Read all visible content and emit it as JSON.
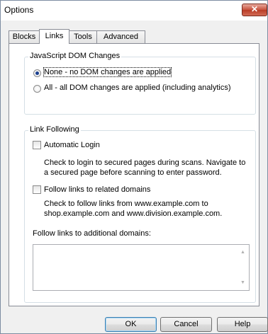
{
  "window": {
    "title": "Options",
    "close_glyph": "✕"
  },
  "tabs": [
    {
      "label": "Blocks",
      "active": false
    },
    {
      "label": "Links",
      "active": true
    },
    {
      "label": "Tools",
      "active": false
    },
    {
      "label": "Advanced",
      "active": false
    }
  ],
  "js_dom": {
    "group_label": "JavaScript DOM Changes",
    "option_none_label": "None - no DOM changes are applied",
    "option_all_label": "All - all DOM changes are applied (including analytics)",
    "selected": "none"
  },
  "link_following": {
    "group_label": "Link Following",
    "auto_login_label": "Automatic Login",
    "auto_login_checked": false,
    "auto_login_desc_1": "Check to login to secured pages during scans. Navigate to",
    "auto_login_desc_2": "a secured page before scanning to enter password.",
    "related_label": "Follow links to related domains",
    "related_checked": false,
    "related_desc_1": "Check to follow links from www.example.com to",
    "related_desc_2": "shop.example.com and www.division.example.com.",
    "additional_label": "Follow links to additional domains:",
    "additional_value": ""
  },
  "buttons": {
    "ok": "OK",
    "cancel": "Cancel",
    "help": "Help"
  },
  "scroll": {
    "up_glyph": "▲",
    "down_glyph": "▼"
  }
}
